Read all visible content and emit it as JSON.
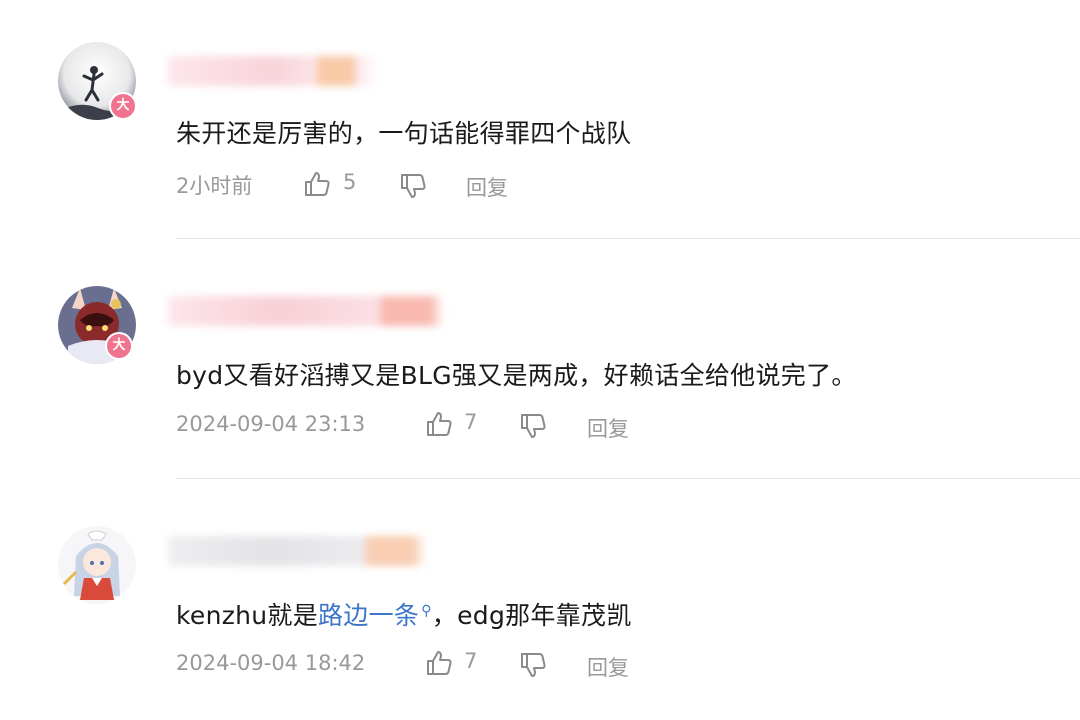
{
  "comments": [
    {
      "badge": "大",
      "text": "朱开还是厉害的，一句话能得罪四个战队",
      "time": "2小时前",
      "likes": "5",
      "reply_label": "回复"
    },
    {
      "badge": "大",
      "text": "byd又看好滔搏又是BLG强又是两成，好赖话全给他说完了。",
      "time": "2024-09-04 23:13",
      "likes": "7",
      "reply_label": "回复"
    },
    {
      "badge": "",
      "text_before": "kenzhu就是",
      "link_text": "路边一条",
      "text_after": "，edg那年靠茂凯",
      "time": "2024-09-04 18:42",
      "likes": "7",
      "reply_label": "回复"
    }
  ],
  "icons": {
    "like": "thumbs-up-icon",
    "dislike": "thumbs-down-icon",
    "link": "search-icon"
  },
  "colors": {
    "badge": "#f0738f",
    "link": "#3d75c8",
    "meta": "#999999"
  }
}
